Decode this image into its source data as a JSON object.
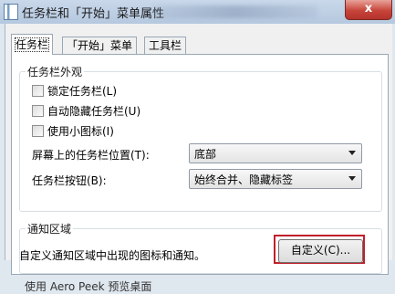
{
  "window": {
    "title": "任务栏和「开始」菜单属性",
    "close_label": "x"
  },
  "tabs": [
    {
      "label": "任务栏",
      "active": true
    },
    {
      "label": "「开始」菜单",
      "active": false
    },
    {
      "label": "工具栏",
      "active": false
    }
  ],
  "appearance": {
    "legend": "任务栏外观",
    "checkboxes": [
      {
        "label": "锁定任务栏(L)",
        "checked": false
      },
      {
        "label": "自动隐藏任务栏(U)",
        "checked": false
      },
      {
        "label": "使用小图标(I)",
        "checked": false
      }
    ],
    "location_label": "屏幕上的任务栏位置(T):",
    "location_value": "底部",
    "buttons_label": "任务栏按钮(B):",
    "buttons_value": "始终合并、隐藏标签"
  },
  "notification": {
    "legend": "通知区域",
    "description": "自定义通知区域中出现的图标和通知。",
    "customize_label": "自定义(C)..."
  },
  "cut_off_text": "使用 Aero Peek 预览桌面"
}
